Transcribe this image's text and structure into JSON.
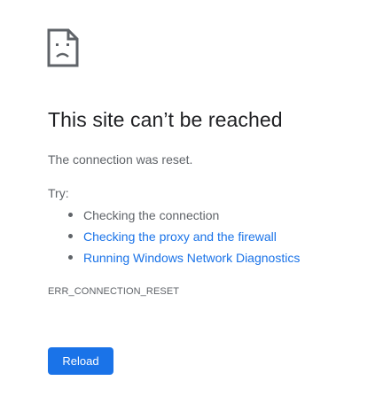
{
  "error_page": {
    "icon": "sad-page-icon",
    "title": "This site can’t be reached",
    "subtitle": "The connection was reset.",
    "try_label": "Try:",
    "suggestions": [
      {
        "label": "Checking the connection",
        "is_link": false
      },
      {
        "label": "Checking the proxy and the firewall",
        "is_link": true
      },
      {
        "label": "Running Windows Network Diagnostics",
        "is_link": true
      }
    ],
    "error_code": "ERR_CONNECTION_RESET",
    "reload_label": "Reload"
  },
  "colors": {
    "title": "#202124",
    "body_text": "#5f6368",
    "link": "#1a73e8",
    "button_bg": "#1a73e8",
    "button_text": "#ffffff"
  }
}
